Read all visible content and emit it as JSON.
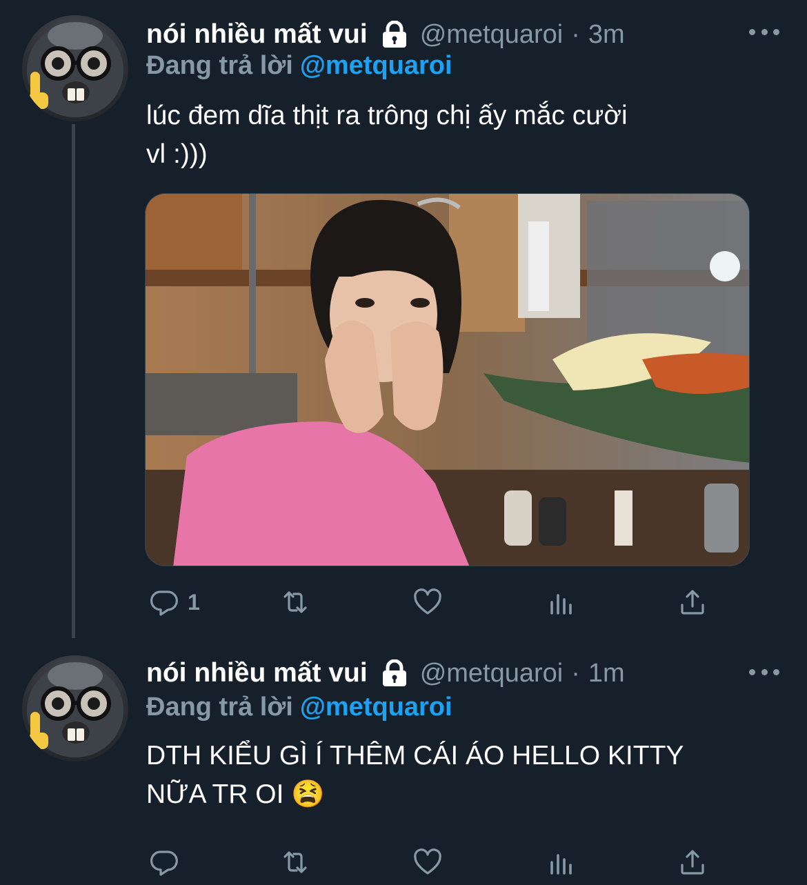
{
  "tweets": [
    {
      "name": "nói nhiều mất vui",
      "handle": "@metquaroi",
      "separator": "·",
      "time": "3m",
      "reply_prefix": "Đang trả lời",
      "reply_handle": "@metquaroi",
      "text_line1": "lúc đem dĩa thịt ra trông chị ấy mắc cười",
      "text_line2": "vl :)))",
      "reply_count": "1",
      "has_media": true
    },
    {
      "name": "nói nhiều mất vui",
      "handle": "@metquaroi",
      "separator": "·",
      "time": "1m",
      "reply_prefix": "Đang trả lời",
      "reply_handle": "@metquaroi",
      "text_line1": "DTH KIỂU GÌ Í THÊM CÁI ÁO HELLO KITTY",
      "text_line2": "NỮA TR OI 😫",
      "reply_count": ""
    }
  ],
  "colors": {
    "background": "#15202b",
    "secondary_text": "#8899a6",
    "link": "#1da1f2",
    "thread_line": "#38444d"
  },
  "icons": [
    "lock-icon",
    "more-icon",
    "reply-icon",
    "retweet-icon",
    "like-icon",
    "analytics-icon",
    "share-icon"
  ]
}
